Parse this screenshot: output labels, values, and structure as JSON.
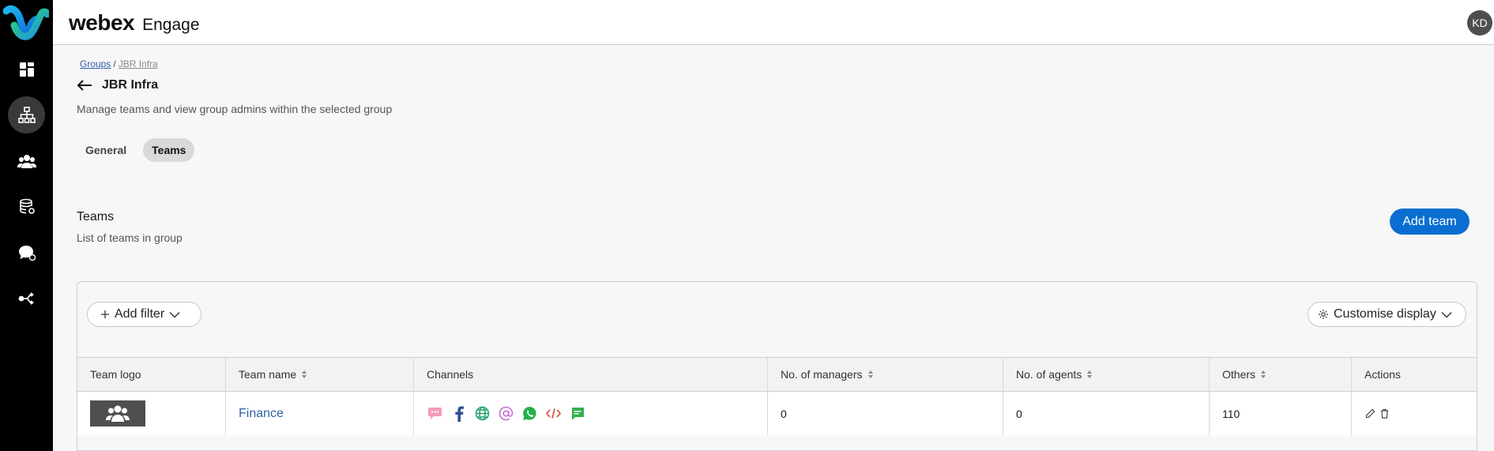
{
  "brand": {
    "name": "webex",
    "product": "Engage"
  },
  "user": {
    "initials": "KD"
  },
  "sidebar": {
    "items": [
      {
        "name": "dashboard-icon"
      },
      {
        "name": "org-hierarchy-icon",
        "active": true
      },
      {
        "name": "users-icon"
      },
      {
        "name": "database-icon"
      },
      {
        "name": "chat-settings-icon"
      },
      {
        "name": "routing-icon"
      }
    ]
  },
  "breadcrumb": {
    "root": "Groups",
    "separator": "/",
    "current": "JBR Infra"
  },
  "page": {
    "title": "JBR Infra",
    "subtitle": "Manage teams and view group admins within the selected group"
  },
  "tabs": [
    {
      "label": "General",
      "active": false
    },
    {
      "label": "Teams",
      "active": true
    }
  ],
  "section": {
    "title": "Teams",
    "subtitle": "List of teams in group",
    "add_button": "Add team"
  },
  "toolbar": {
    "add_filter": "Add filter",
    "customise": "Customise display"
  },
  "table": {
    "columns": [
      "Team logo",
      "Team name",
      "Channels",
      "No. of managers",
      "No. of agents",
      "Others",
      "Actions"
    ],
    "rows": [
      {
        "team_name": "Finance",
        "channels": [
          "sms-icon",
          "facebook-icon",
          "web-icon",
          "email-icon",
          "whatsapp-icon",
          "code-icon",
          "chat-icon"
        ],
        "managers": "0",
        "agents": "0",
        "others": "110"
      }
    ]
  },
  "colors": {
    "accent": "#0a6ed1",
    "link": "#2f5fa8",
    "sidebar": "#000000"
  }
}
